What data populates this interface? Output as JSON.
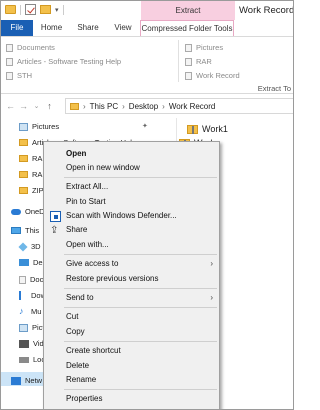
{
  "window": {
    "title": "Work Record"
  },
  "ribbon": {
    "context_label": "Extract",
    "tabs": [
      "File",
      "Home",
      "Share",
      "View",
      "Compressed Folder Tools"
    ],
    "left_items": [
      "Documents",
      "Articles - Software Testing Help",
      "STH"
    ],
    "right_items": [
      "Pictures",
      "RAR",
      "Work Record"
    ],
    "extract_to": "Extract To"
  },
  "address": {
    "crumbs": [
      "This PC",
      "Desktop",
      "Work Record"
    ]
  },
  "navpane": {
    "items": [
      "Pictures",
      "Articles - Software Testing Help",
      "RAR",
      "RAR",
      "ZIP",
      "OneDrive",
      "This PC",
      "3D",
      "Desktop",
      "Documents",
      "Downloads",
      "Music",
      "Pictures",
      "Videos",
      "Local Disk",
      "Network"
    ],
    "short": [
      "Pictures",
      "Articles - Software Testing Help",
      "RAF",
      "RAF",
      "ZIP",
      "OneD",
      "This",
      "3D",
      "Des",
      "Doc",
      "Dow",
      "Mu",
      "Pict",
      "Vide",
      "Loc",
      "Netw"
    ]
  },
  "content": {
    "items": [
      "Work1",
      "Work"
    ]
  },
  "menu": {
    "items": [
      "Open",
      "Open in new window",
      "Extract All...",
      "Pin to Start",
      "Scan with Windows Defender...",
      "Share",
      "Open with...",
      "Give access to",
      "Restore previous versions",
      "Send to",
      "Cut",
      "Copy",
      "Create shortcut",
      "Delete",
      "Rename",
      "Properties"
    ]
  }
}
